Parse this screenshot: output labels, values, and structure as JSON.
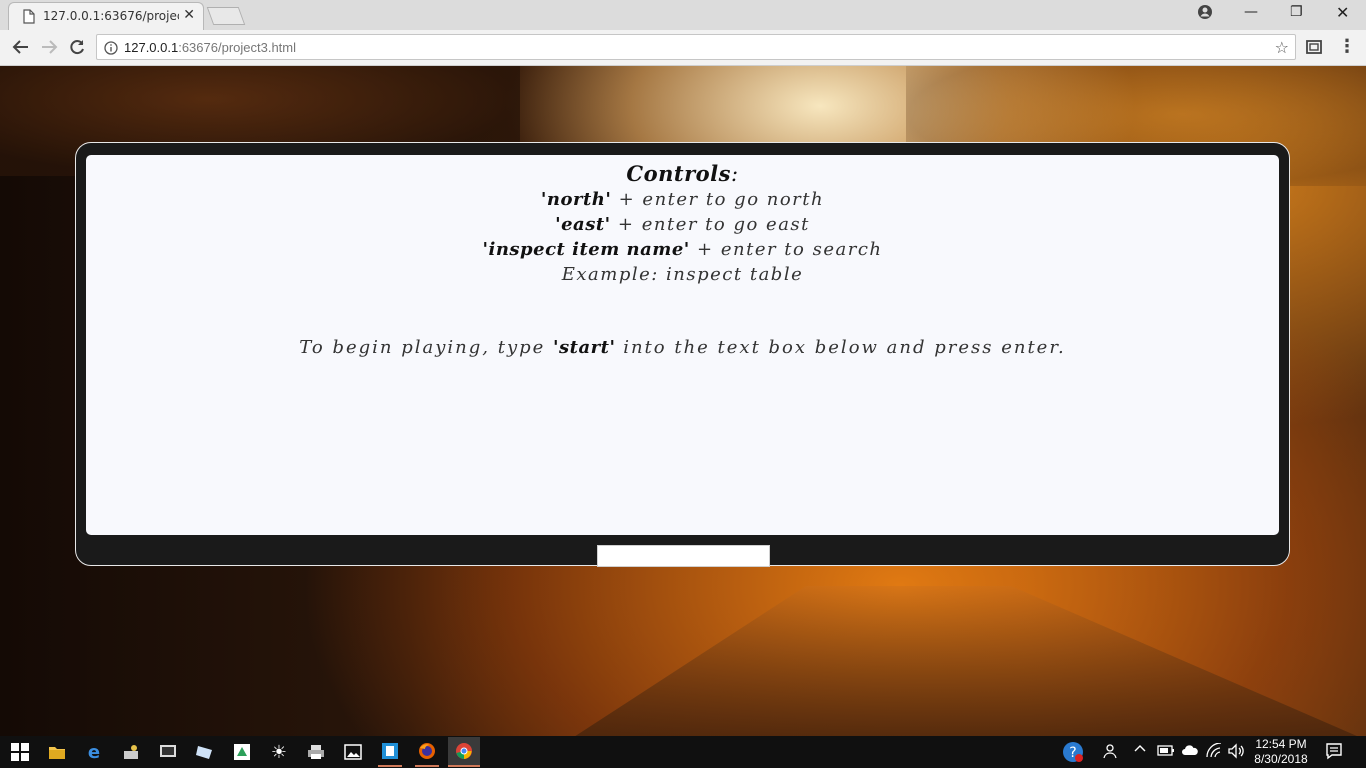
{
  "browser": {
    "tab_title": "127.0.0.1:63676/project3.",
    "url_host": "127.0.0.1",
    "url_rest": ":63676/project3.html"
  },
  "game": {
    "heading": "Controls",
    "heading_colon": ":",
    "controls": [
      {
        "cmd": "'north'",
        "text": " + enter to go north"
      },
      {
        "cmd": "'east'",
        "text": " + enter to go east"
      },
      {
        "cmd": "'inspect item name'",
        "text": " + enter to search"
      }
    ],
    "example": "Example: inspect table",
    "instructions_before": "To begin playing, type ",
    "instructions_cmd": "'start'",
    "instructions_after": " into the text box below and press enter.",
    "input_value": ""
  },
  "taskbar": {
    "time": "12:54 PM",
    "date": "8/30/2018"
  },
  "colors": {
    "frame": "#1a1a1a",
    "screen": "#f8f9fd",
    "taskbar": "#101010"
  }
}
